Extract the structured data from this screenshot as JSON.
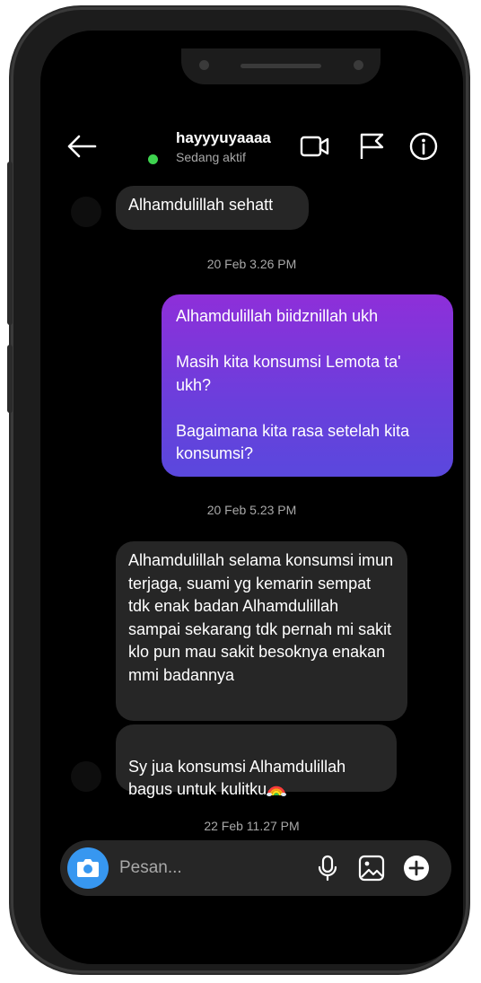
{
  "header": {
    "username": "hayyyuyaaaa",
    "status": "Sedang aktif"
  },
  "messages": [
    {
      "type": "incoming",
      "text": "Alhamdulillah sehatt"
    },
    {
      "type": "timestamp",
      "text": "20 Feb 3.26 PM"
    },
    {
      "type": "outgoing",
      "text": "Alhamdulillah biidznillah ukh\n\nMasih kita konsumsi Lemota ta' ukh?\n\nBagaimana kita rasa setelah kita konsumsi?"
    },
    {
      "type": "timestamp",
      "text": "20 Feb 5.23 PM"
    },
    {
      "type": "incoming",
      "text": "Alhamdulillah selama konsumsi imun terjaga, suami yg kemarin sempat tdk enak badan Alhamdulillah sampai sekarang tdk pernah mi sakit klo pun mau sakit besoknya enakan mmi badannya"
    },
    {
      "type": "incoming",
      "text": "Sy jua konsumsi Alhamdulillah bagus untuk kulitku",
      "emoji": "rainbow"
    },
    {
      "type": "timestamp",
      "text": "22 Feb 11.27 PM"
    }
  ],
  "composer": {
    "placeholder": "Pesan..."
  },
  "colors": {
    "accent": "#3797f0",
    "online": "#3ed34f",
    "bubble_in": "#262626",
    "bubble_out_top": "#8e2fd9",
    "bubble_out_bottom": "#5a48dd"
  },
  "icons": [
    "back-arrow-icon",
    "video-call-icon",
    "flag-icon",
    "info-icon",
    "camera-icon",
    "microphone-icon",
    "gallery-icon",
    "add-icon",
    "rainbow-icon"
  ]
}
